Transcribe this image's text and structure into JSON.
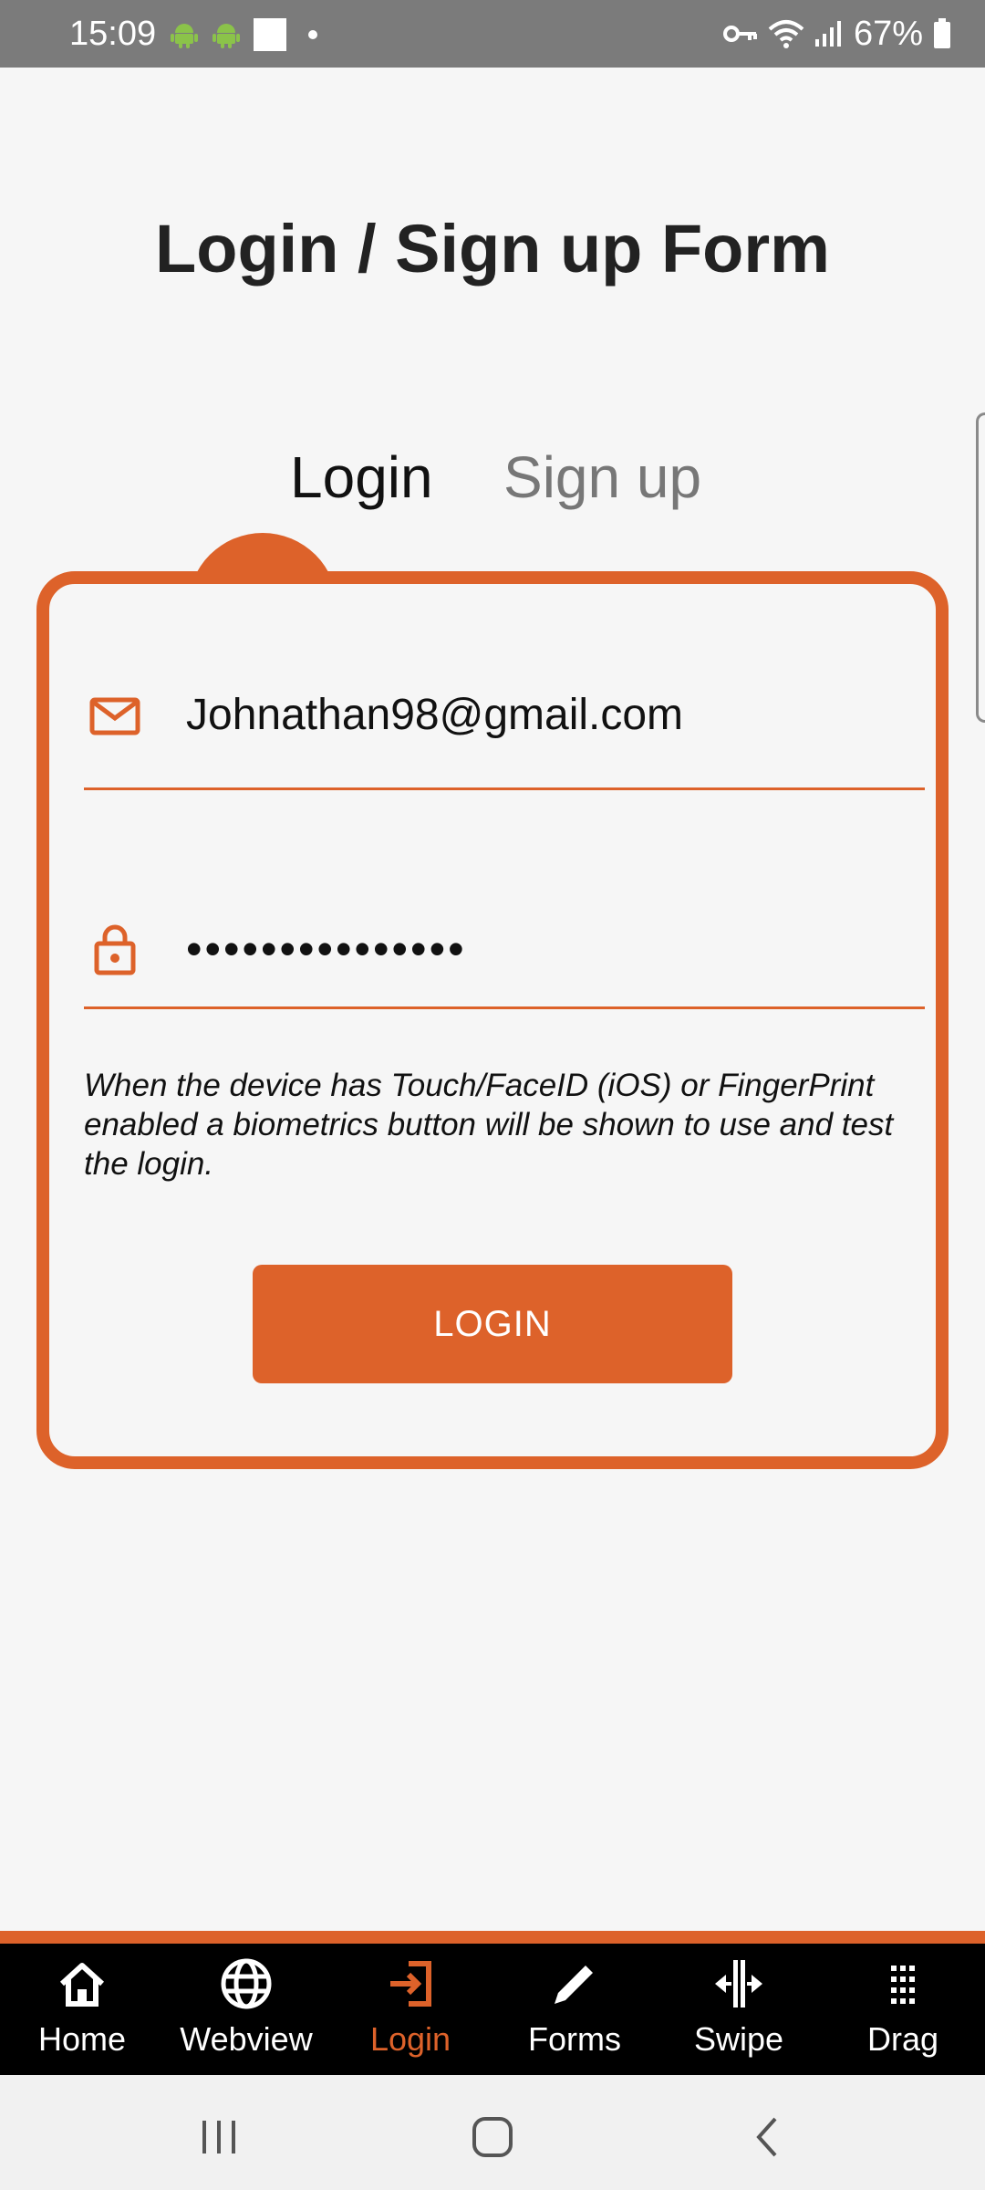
{
  "status_bar": {
    "time": "15:09",
    "battery": "67%",
    "icons": [
      "android-icon",
      "android-icon",
      "notification-square-icon",
      "dot-icon",
      "vpn-key-icon",
      "wifi-icon",
      "signal-icon",
      "battery-icon"
    ]
  },
  "page": {
    "title": "Login / Sign up Form"
  },
  "tabs": {
    "login": "Login",
    "signup": "Sign up",
    "active": "login"
  },
  "form": {
    "email_value": "Johnathan98@gmail.com",
    "email_icon": "mail-icon",
    "password_value": "•••••••••••••••",
    "password_icon": "lock-icon",
    "hint": "When the device has Touch/FaceID (iOS) or FingerPrint enabled a biometrics button will be shown to use and test the login.",
    "login_button": "LOGIN"
  },
  "bottom_nav": {
    "items": [
      {
        "label": "Home",
        "icon": "home-icon"
      },
      {
        "label": "Webview",
        "icon": "globe-icon"
      },
      {
        "label": "Login",
        "icon": "login-icon"
      },
      {
        "label": "Forms",
        "icon": "pencil-icon"
      },
      {
        "label": "Swipe",
        "icon": "swipe-icon"
      },
      {
        "label": "Drag",
        "icon": "grid-dots-icon"
      }
    ],
    "active_index": 2
  },
  "system_nav": {
    "buttons": [
      "recents-icon",
      "home-circle-icon",
      "back-icon"
    ]
  },
  "colors": {
    "accent": "#dd622a",
    "status_bar": "#7b7b7b",
    "background": "#f6f6f6",
    "nav_background": "#000000"
  }
}
